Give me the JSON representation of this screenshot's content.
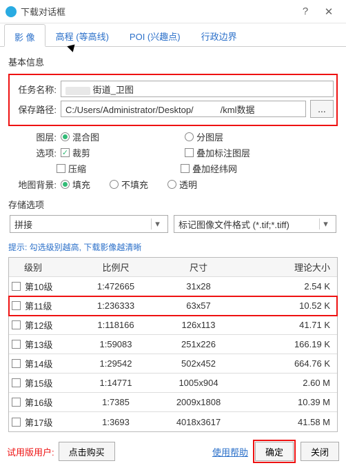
{
  "title": "下载对话框",
  "titlebar": {
    "help": "?",
    "close": "✕"
  },
  "tabs": [
    {
      "label": "影 像",
      "active": true
    },
    {
      "label": "高程 (等高线)"
    },
    {
      "label": "POI (兴趣点)"
    },
    {
      "label": "行政边界"
    }
  ],
  "basic": {
    "group": "基本信息",
    "taskLabel": "任务名称:",
    "taskValue": "街道_卫图",
    "pathLabel": "保存路径:",
    "pathValue": "C:/Users/Administrator/Desktop/　　　/kml数据",
    "browse": "...",
    "layerLabel": "图层:",
    "layer_mixed": "混合图",
    "layer_split": "分图层",
    "optionLabel": "选项:",
    "opt_crop": "裁剪",
    "opt_compress": "压缩",
    "opt_overlay_layer": "叠加标注图层",
    "opt_overlay_grid": "叠加经纬网",
    "bgLabel": "地图背景:",
    "bg_fill": "填充",
    "bg_nofill": "不填充",
    "bg_trans": "透明"
  },
  "storage": {
    "label": "存储选项",
    "mode": "拼接",
    "format": "标记图像文件格式 (*.tif;*.tiff)"
  },
  "hint": "提示: 勾选级别越高, 下载影像越清晰",
  "table": {
    "headers": {
      "level": "级别",
      "scale": "比例尺",
      "size": "尺寸",
      "theo": "理论大小"
    },
    "rows": [
      {
        "level": "第10级",
        "scale": "1:472665",
        "size": "31x28",
        "theo": "2.54 K",
        "checked": false
      },
      {
        "level": "第11级",
        "scale": "1:236333",
        "size": "63x57",
        "theo": "10.52 K",
        "checked": false,
        "hl": true
      },
      {
        "level": "第12级",
        "scale": "1:118166",
        "size": "126x113",
        "theo": "41.71 K",
        "checked": false
      },
      {
        "level": "第13级",
        "scale": "1:59083",
        "size": "251x226",
        "theo": "166.19 K",
        "checked": false
      },
      {
        "level": "第14级",
        "scale": "1:29542",
        "size": "502x452",
        "theo": "664.76 K",
        "checked": false
      },
      {
        "level": "第15级",
        "scale": "1:14771",
        "size": "1005x904",
        "theo": "2.60 M",
        "checked": false
      },
      {
        "level": "第16级",
        "scale": "1:7385",
        "size": "2009x1808",
        "theo": "10.39 M",
        "checked": false
      },
      {
        "level": "第17级",
        "scale": "1:3693",
        "size": "4018x3617",
        "theo": "41.58 M",
        "checked": false
      }
    ]
  },
  "footer": {
    "trial": "试用版用户:",
    "buy": "点击购买",
    "help": "使用帮助",
    "ok": "确定",
    "close": "关闭"
  }
}
